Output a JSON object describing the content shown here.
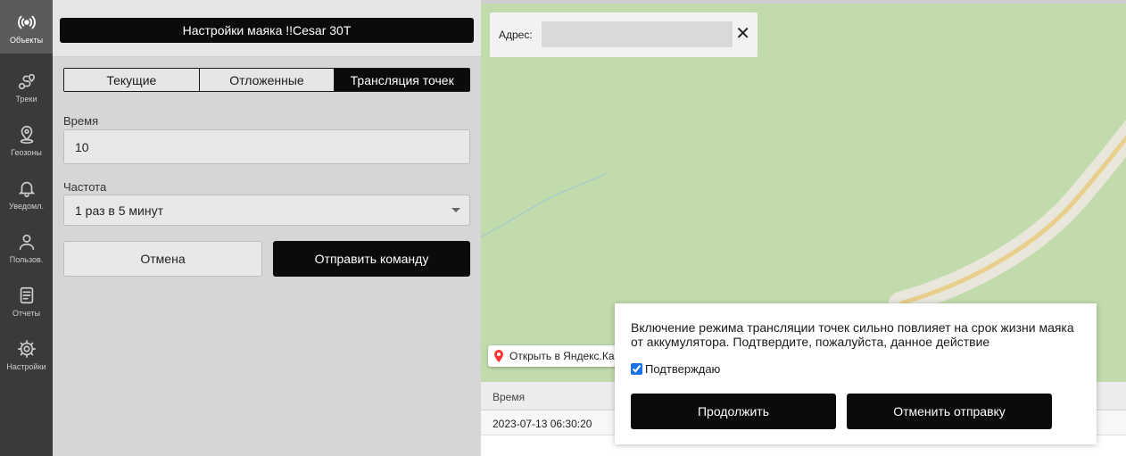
{
  "sidebar": {
    "items": [
      {
        "label": "Объекты",
        "icon": "broadcast-icon"
      },
      {
        "label": "Треки",
        "icon": "route-icon"
      },
      {
        "label": "Геозоны",
        "icon": "geozone-pin-icon"
      },
      {
        "label": "Уведомл.",
        "icon": "bell-icon"
      },
      {
        "label": "Пользов.",
        "icon": "user-icon"
      },
      {
        "label": "Отчеты",
        "icon": "document-icon"
      },
      {
        "label": "Настройки",
        "icon": "gear-icon"
      }
    ]
  },
  "panel": {
    "title": "Настройки маяка !!Cesar 30T",
    "tabs": [
      "Текущие",
      "Отложенные",
      "Трансляция точек"
    ],
    "time_label": "Время",
    "time_value": "10",
    "frequency_label": "Частота",
    "frequency_value": "1 раз в 5 минут",
    "cancel_label": "Отмена",
    "send_label": "Отправить команду"
  },
  "map": {
    "address_label": "Адрес:",
    "address_value": "",
    "close_symbol": "✕",
    "yandex_link": "Открыть в Яндекс.Картах"
  },
  "table": {
    "column_time": "Время",
    "rows": [
      {
        "time": "2023-07-13 06:30:20"
      }
    ]
  },
  "dialog": {
    "message": "Включение режима трансляции точек сильно повлияет на срок жизни маяка от аккумулятора. Подтвердите, пожалуйста, данное действие",
    "confirm_label": "Подтверждаю",
    "confirm_checked": true,
    "continue_label": "Продолжить",
    "abort_label": "Отменить отправку"
  },
  "colors": {
    "sidebar_bg": "#3a3a3c",
    "active_nav": "#5b5b5e",
    "map_green": "#c1dbad",
    "primary_dark": "#0b0b0b"
  }
}
